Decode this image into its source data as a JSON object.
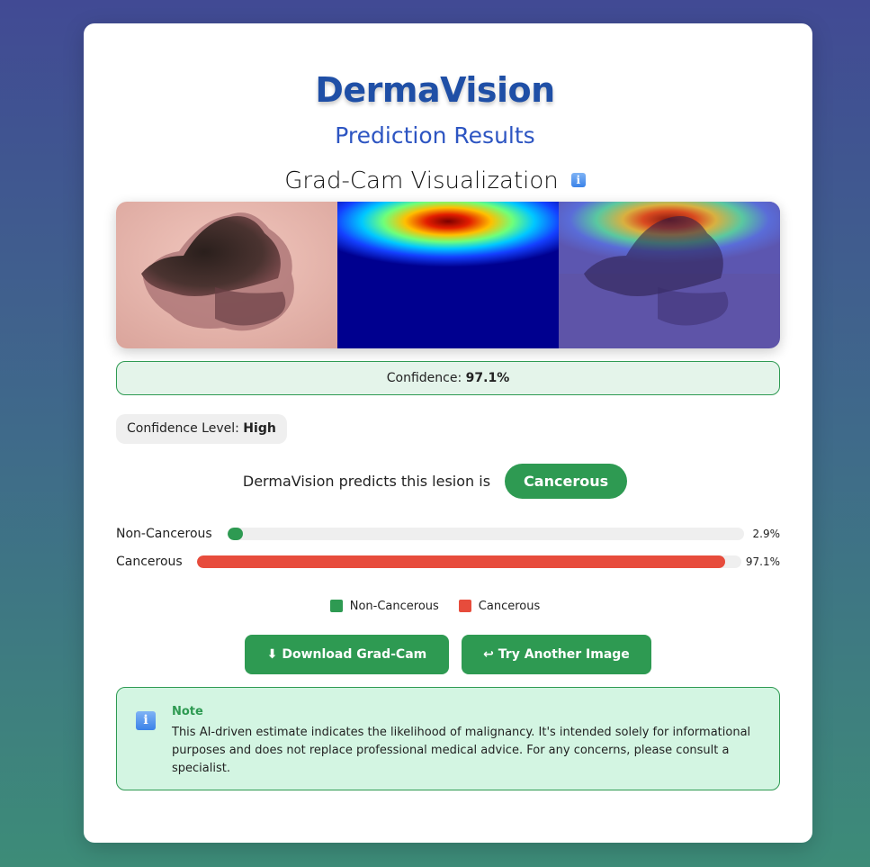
{
  "app": {
    "brand": "DermaVision",
    "subtitle": "Prediction Results"
  },
  "gradcam": {
    "title": "Grad-Cam Visualization",
    "info_icon": "info-icon",
    "images": [
      "original-lesion-image",
      "gradcam-heatmap-image",
      "overlay-image"
    ]
  },
  "confidence": {
    "label": "Confidence:",
    "value": "97.1%"
  },
  "confidence_level": {
    "label": "Confidence Level:",
    "value": "High"
  },
  "prediction": {
    "text": "DermaVision predicts this lesion is",
    "result": "Cancerous"
  },
  "bars": [
    {
      "label": "Non-Cancerous",
      "value_text": "2.9%",
      "fraction": 0.029,
      "color": "#2e9a52"
    },
    {
      "label": "Cancerous",
      "value_text": "97.1%",
      "fraction": 0.971,
      "color": "#e74c3c"
    }
  ],
  "legend": [
    {
      "label": "Non-Cancerous",
      "color": "#2e9a52"
    },
    {
      "label": "Cancerous",
      "color": "#e74c3c"
    }
  ],
  "buttons": {
    "download": "⬇ Download Grad-Cam",
    "try_another": "↩ Try Another Image"
  },
  "note": {
    "title": "Note",
    "body": "This AI-driven estimate indicates the likelihood of malignancy. It's intended solely for informational purposes and does not replace professional medical advice. For any concerns, please consult a specialist."
  },
  "colors": {
    "accent": "#2e9a52",
    "danger": "#e74c3c",
    "brand": "#1f4fa6"
  }
}
